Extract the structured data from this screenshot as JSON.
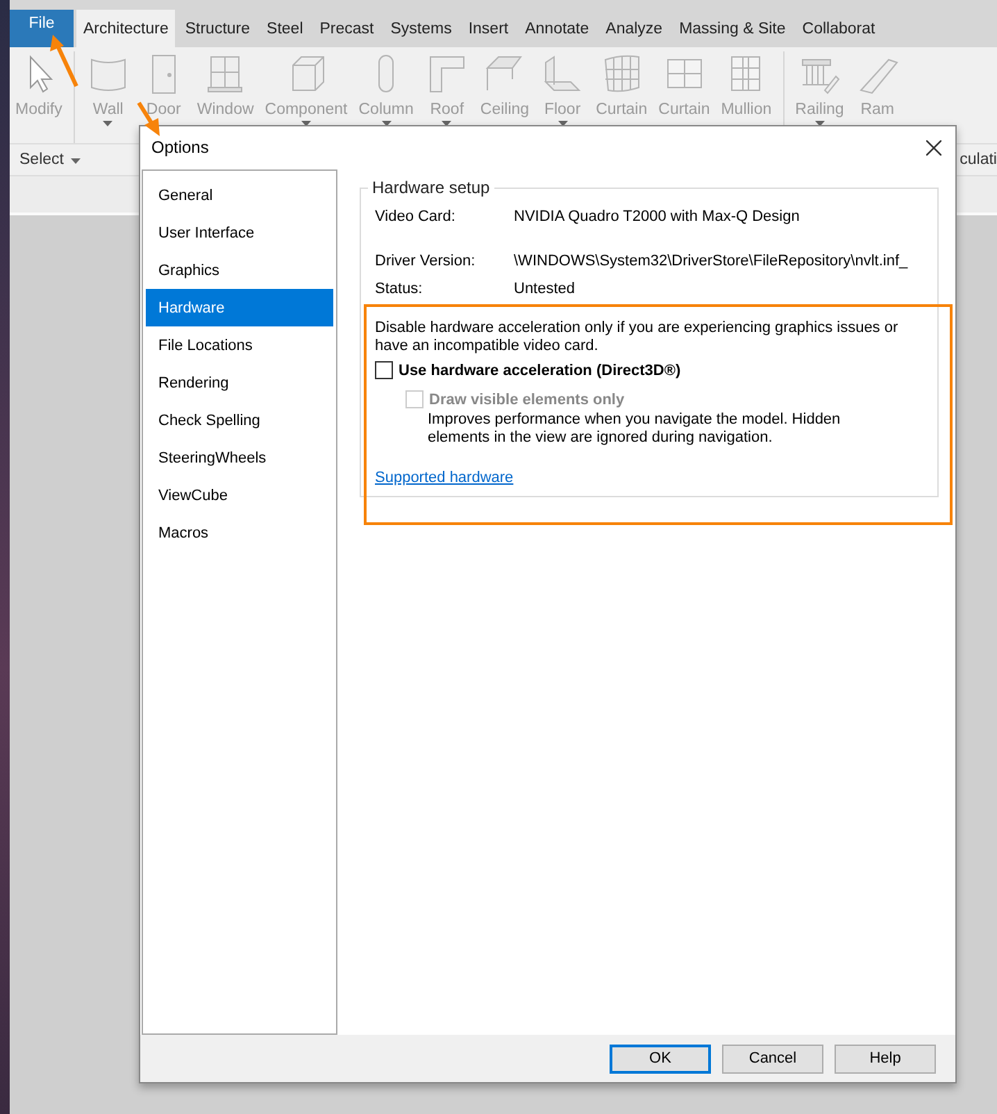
{
  "ribbon": {
    "tabs": [
      {
        "label": "File",
        "kind": "application",
        "selected": false
      },
      {
        "label": "Architecture",
        "kind": "tab",
        "selected": true
      },
      {
        "label": "Structure",
        "kind": "tab",
        "selected": false
      },
      {
        "label": "Steel",
        "kind": "tab",
        "selected": false
      },
      {
        "label": "Precast",
        "kind": "tab",
        "selected": false
      },
      {
        "label": "Systems",
        "kind": "tab",
        "selected": false
      },
      {
        "label": "Insert",
        "kind": "tab",
        "selected": false
      },
      {
        "label": "Annotate",
        "kind": "tab",
        "selected": false
      },
      {
        "label": "Analyze",
        "kind": "tab",
        "selected": false
      },
      {
        "label": "Massing & Site",
        "kind": "tab",
        "selected": false
      },
      {
        "label": "Collaborat",
        "kind": "tab",
        "selected": false
      }
    ],
    "tools": [
      {
        "label": "Modify",
        "kind": "cursor",
        "dropdown": false,
        "disabled": true
      },
      {
        "label": "Wall",
        "kind": "wall",
        "dropdown": true,
        "disabled": true
      },
      {
        "label": "Door",
        "kind": "door",
        "dropdown": false,
        "disabled": true
      },
      {
        "label": "Window",
        "kind": "window",
        "dropdown": false,
        "disabled": true
      },
      {
        "label": "Component",
        "kind": "component",
        "dropdown": true,
        "disabled": true
      },
      {
        "label": "Column",
        "kind": "column",
        "dropdown": true,
        "disabled": true
      },
      {
        "label": "Roof",
        "kind": "roof",
        "dropdown": true,
        "disabled": true
      },
      {
        "label": "Ceiling",
        "kind": "ceiling",
        "dropdown": false,
        "disabled": true
      },
      {
        "label": "Floor",
        "kind": "floor",
        "dropdown": true,
        "disabled": true
      },
      {
        "label": "Curtain",
        "kind": "curtain",
        "dropdown": false,
        "disabled": true
      },
      {
        "label": "Curtain",
        "kind": "grid",
        "dropdown": false,
        "disabled": true
      },
      {
        "label": "Mullion",
        "kind": "mullion",
        "dropdown": false,
        "disabled": true
      },
      {
        "label": "Railing",
        "kind": "railing",
        "dropdown": true,
        "disabled": true
      },
      {
        "label": "Ram",
        "kind": "ramp",
        "dropdown": false,
        "disabled": true
      }
    ],
    "panels": [
      {
        "label": "Select",
        "dropdown": true
      },
      {
        "label": "culati",
        "dropdown": false
      }
    ]
  },
  "dialog": {
    "title": "Options",
    "nav": [
      {
        "label": "General",
        "selected": false
      },
      {
        "label": "User Interface",
        "selected": false
      },
      {
        "label": "Graphics",
        "selected": false
      },
      {
        "label": "Hardware",
        "selected": true
      },
      {
        "label": "File Locations",
        "selected": false
      },
      {
        "label": "Rendering",
        "selected": false
      },
      {
        "label": "Check Spelling",
        "selected": false
      },
      {
        "label": "SteeringWheels",
        "selected": false
      },
      {
        "label": "ViewCube",
        "selected": false
      },
      {
        "label": "Macros",
        "selected": false
      }
    ],
    "group": {
      "title": "Hardware setup",
      "fields": [
        {
          "label": "Video Card:",
          "value": "NVIDIA Quadro T2000 with Max-Q Design"
        },
        {
          "label": "Driver Version:",
          "value": "\\WINDOWS\\System32\\DriverStore\\FileRepository\\nvlt.inf_"
        },
        {
          "label": "Status:",
          "value": "Untested"
        }
      ],
      "note": "Disable hardware acceleration only if you are experiencing graphics issues or have an incompatible video card.",
      "options": [
        {
          "label": "Use hardware acceleration (Direct3D®)",
          "checked": false,
          "disabled": false,
          "indent": false
        },
        {
          "label": "Draw visible elements only",
          "checked": false,
          "disabled": true,
          "indent": true,
          "description": "Improves performance when you navigate the model. Hidden elements in the view are ignored during navigation."
        }
      ],
      "link": "Supported hardware"
    },
    "buttons": [
      {
        "label": "OK",
        "default": true
      },
      {
        "label": "Cancel",
        "default": false
      },
      {
        "label": "Help",
        "default": false
      }
    ]
  }
}
